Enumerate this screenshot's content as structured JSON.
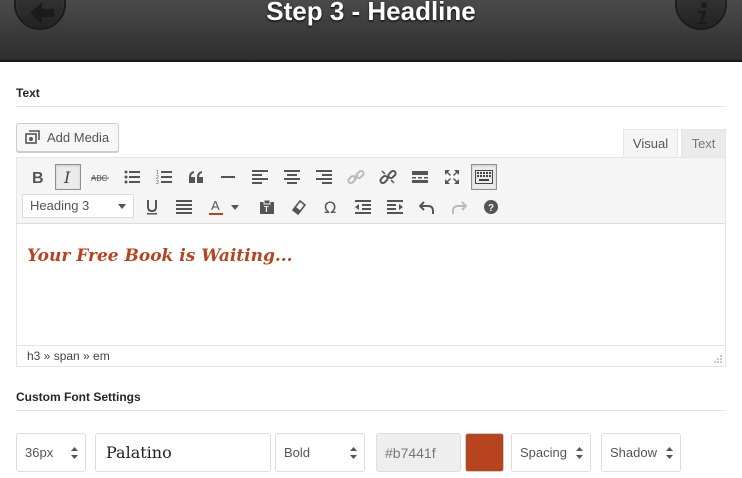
{
  "header": {
    "title": "Step 3 - Headline",
    "back_icon": "arrow-left-icon",
    "info_icon": "info-icon"
  },
  "text_section": {
    "label": "Text",
    "add_media_label": "Add Media",
    "tabs": {
      "visual": "Visual",
      "text": "Text"
    },
    "format_select": "Heading 3",
    "content": "Your Free Book is Waiting...",
    "status_path": "h3 » span » em",
    "content_color": "#b7441f",
    "toolbar_row1": [
      "bold",
      "italic",
      "strikethrough",
      "bulleted-list",
      "numbered-list",
      "blockquote",
      "horizontal-line",
      "align-left",
      "align-center",
      "align-right",
      "insert-link",
      "remove-link",
      "read-more",
      "fullscreen",
      "toolbar-toggle"
    ],
    "toolbar_row2": [
      "underline",
      "justify",
      "text-color",
      "paste-as-text",
      "clear-formatting",
      "special-character",
      "decrease-indent",
      "increase-indent",
      "undo",
      "redo",
      "help"
    ]
  },
  "font_settings": {
    "label": "Custom Font Settings",
    "size": "36px",
    "font": "Palatino",
    "weight": "Bold",
    "color_hex": "#b7441f",
    "swatch_color": "#b7441f",
    "spacing": "Spacing",
    "shadow": "Shadow"
  }
}
